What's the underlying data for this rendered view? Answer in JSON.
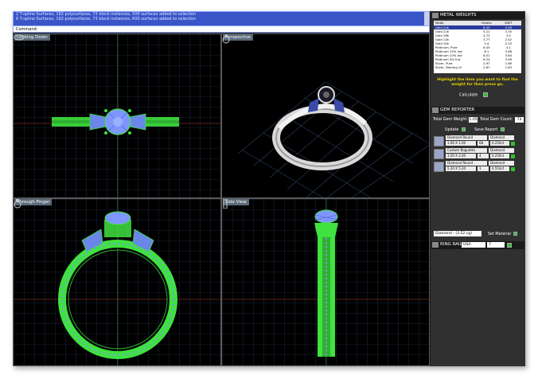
{
  "command": {
    "lines": [
      "2 T-spline Surfaces, 162 polysurfaces, 73 block instances, 500 surfaces added to selection",
      "6 T-spline Surfaces, 162 polysurfaces, 73 block instances, 600 surfaces added to selection"
    ],
    "prompt": "Command:"
  },
  "viewports": {
    "top_left": "Looking Down",
    "top_right": "Perspective",
    "bottom_left": "Through Finger",
    "bottom_right": "Side View"
  },
  "metal_weights": {
    "title": "METAL WEIGHTS",
    "columns": [
      "Metal",
      "Grams",
      "DWT"
    ],
    "rows": [
      {
        "metal": "Gold 24k",
        "grams": "8.45",
        "dwt": "5.49",
        "selected": true
      },
      {
        "metal": "Gold 22k",
        "grams": "5.21",
        "dwt": "3.35"
      },
      {
        "metal": "Gold 18k",
        "grams": "4.72",
        "dwt": "3.0"
      },
      {
        "metal": "Gold 14k",
        "grams": "3.77",
        "dwt": "2.42"
      },
      {
        "metal": "Gold 10k",
        "grams": "3.4",
        "dwt": "2.15"
      },
      {
        "metal": "Platinum, Pure",
        "grams": "6.45",
        "dwt": "4.1"
      },
      {
        "metal": "Platinum 15% Ind",
        "grams": "6.1",
        "dwt": "3.88"
      },
      {
        "metal": "Platinum 10% Ind",
        "grams": "6.01",
        "dwt": "3.84"
      },
      {
        "metal": "Platinum 5% Ind",
        "grams": "6.24",
        "dwt": "3.99"
      },
      {
        "metal": "Silver, Pure",
        "grams": "2.97",
        "dwt": "1.89"
      },
      {
        "metal": "Silver, Sterling (9",
        "grams": "2.87",
        "dwt": "1.83"
      }
    ],
    "note": "Highlight the item you want to find the weight for then press go.",
    "calculate_label": "Calculate"
  },
  "gem_reporter": {
    "title": "GEM REPORTER",
    "total_weight_label": "Total Gem Weight:",
    "total_weight_value": "1.05",
    "total_count_label": "Total Gem Count:",
    "total_count_value": "73",
    "update_label": "Update",
    "save_label": "Save Report",
    "gems": [
      {
        "shape": "Diamond Round",
        "material": "Diamond",
        "size": "1.00 X 1.00",
        "count": "68",
        "weight": "0.250ct"
      },
      {
        "shape": "Custom Baguette",
        "material": "Diamond",
        "size": "3.50 X 2.00",
        "count": "4",
        "weight": "0.250ct"
      },
      {
        "shape": "Diamond Round",
        "material": "Diamond",
        "size": "5.20 X 5.20",
        "count": "1",
        "weight": "0.553ct"
      }
    ],
    "material_select": "Diamond - (3.52 cg)",
    "set_material_label": "Set Material"
  },
  "ring_rail": {
    "title": "RING RAIL",
    "size_system": "USA",
    "size_value": "7"
  },
  "colors": {
    "command_bg": "#3a55c8",
    "wire_green": "#3fe23f",
    "stone_blue": "#7f96ff",
    "grid_line": "#2f4260",
    "panel_bg": "#303030"
  }
}
